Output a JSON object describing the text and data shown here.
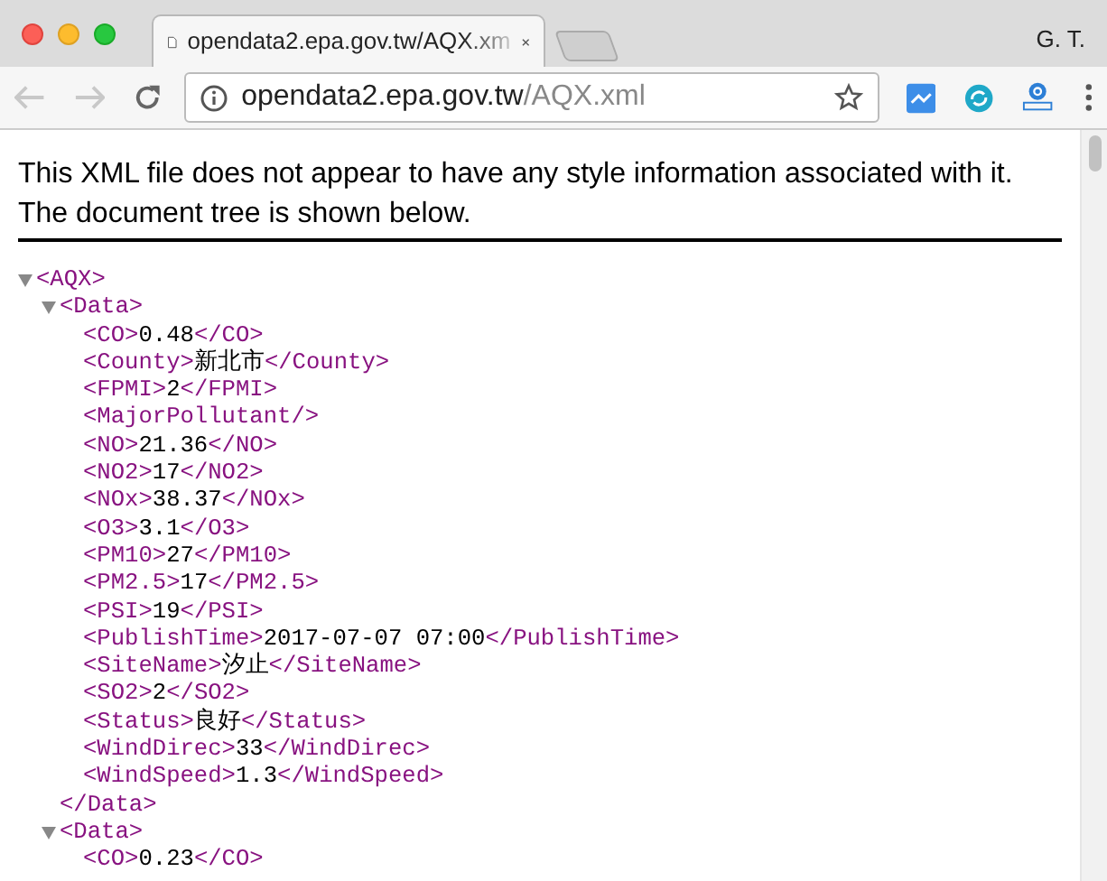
{
  "window": {
    "tab": {
      "title": "opendata2.epa.gov.tw/AQX.xm",
      "selected": true
    },
    "profile": "G. T.",
    "address": {
      "host": "opendata2.epa.gov.tw",
      "path": "/AQX.xml"
    }
  },
  "notice": "This XML file does not appear to have any style information associated with it. The document tree is shown below.",
  "tree": [
    {
      "open": "<AQX>",
      "expanded": true,
      "children": [
        {
          "open": "<Data>",
          "expanded": true,
          "children": [
            {
              "open": "<CO>",
              "value": "0.48",
              "close": "</CO>"
            },
            {
              "open": "<County>",
              "value": "新北市",
              "close": "</County>"
            },
            {
              "open": "<FPMI>",
              "value": "2",
              "close": "</FPMI>"
            },
            {
              "open": "<MajorPollutant/>"
            },
            {
              "open": "<NO>",
              "value": "21.36",
              "close": "</NO>"
            },
            {
              "open": "<NO2>",
              "value": "17",
              "close": "</NO2>"
            },
            {
              "open": "<NOx>",
              "value": "38.37",
              "close": "</NOx>"
            },
            {
              "open": "<O3>",
              "value": "3.1",
              "close": "</O3>"
            },
            {
              "open": "<PM10>",
              "value": "27",
              "close": "</PM10>"
            },
            {
              "open": "<PM2.5>",
              "value": "17",
              "close": "</PM2.5>"
            },
            {
              "open": "<PSI>",
              "value": "19",
              "close": "</PSI>"
            },
            {
              "open": "<PublishTime>",
              "value": "2017-07-07 07:00",
              "close": "</PublishTime>"
            },
            {
              "open": "<SiteName>",
              "value": "汐止",
              "close": "</SiteName>"
            },
            {
              "open": "<SO2>",
              "value": "2",
              "close": "</SO2>"
            },
            {
              "open": "<Status>",
              "value": "良好",
              "close": "</Status>"
            },
            {
              "open": "<WindDirec>",
              "value": "33",
              "close": "</WindDirec>"
            },
            {
              "open": "<WindSpeed>",
              "value": "1.3",
              "close": "</WindSpeed>"
            }
          ],
          "close": "</Data>"
        },
        {
          "open": "<Data>",
          "expanded": true,
          "children": [
            {
              "open": "<CO>",
              "value": "0.23",
              "close": "</CO>"
            }
          ]
        }
      ]
    }
  ]
}
